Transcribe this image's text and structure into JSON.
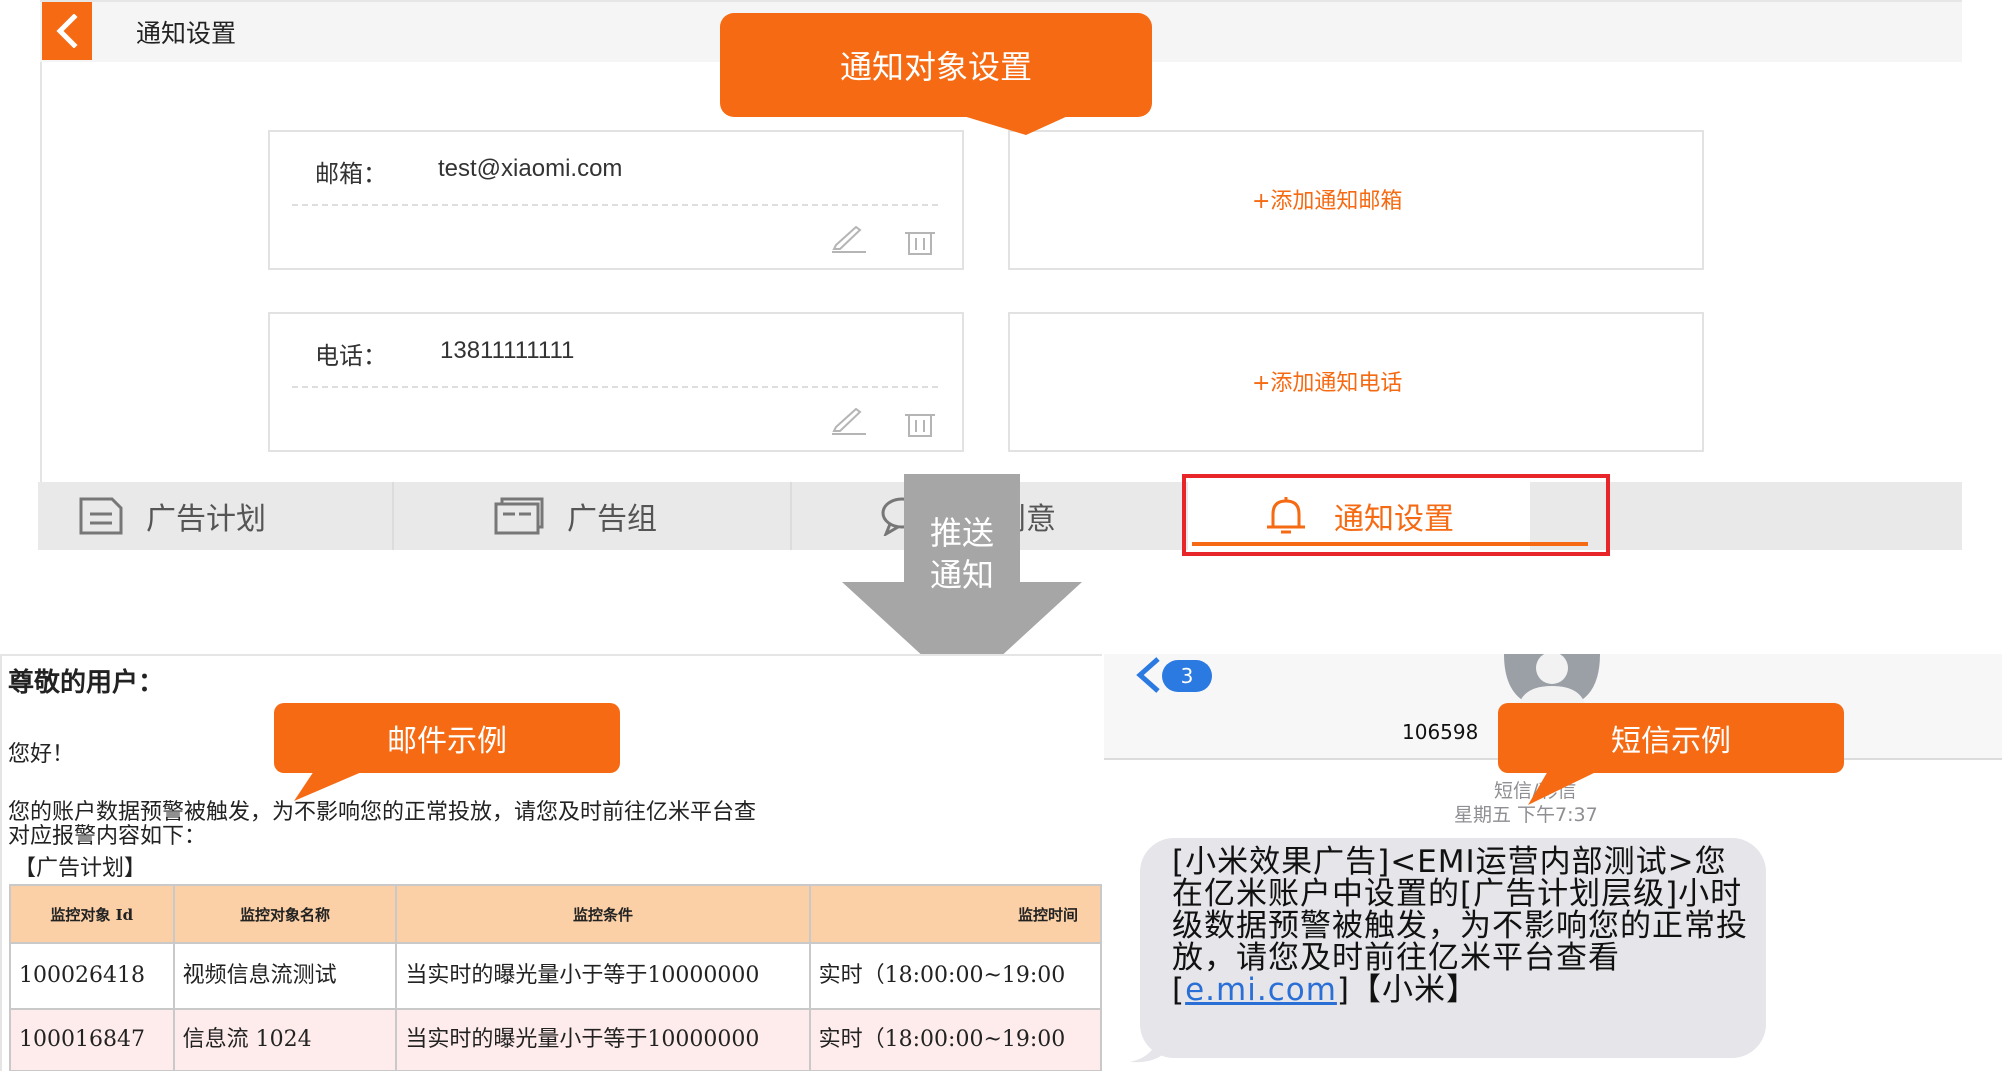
{
  "settings": {
    "header_title": "通知设置",
    "email_label": "邮箱：",
    "email_value": "test@xiaomi.com",
    "phone_label": "电话：",
    "phone_value": "13811111111",
    "add_email": "+添加通知邮箱",
    "add_phone": "+添加通知电话"
  },
  "tabs": [
    {
      "label": "广告计划",
      "icon": "document-icon"
    },
    {
      "label": "广告组",
      "icon": "folder-icon"
    },
    {
      "label": "广告创意",
      "icon": "chat-bubble-icon"
    },
    {
      "label": "通知设置",
      "icon": "bell-icon",
      "active": true
    }
  ],
  "callouts": {
    "target": "通知对象设置",
    "email_example": "邮件示例",
    "sms_example": "短信示例"
  },
  "arrow": {
    "line1": "推送",
    "line2": "通知"
  },
  "email": {
    "greeting": "尊敬的用户：",
    "hello": "您好！",
    "body": "您的账户数据预警被触发，为不影响您的正常投放，请您及时前往亿米平台查",
    "body2": "对应报警内容如下：",
    "section": "【广告计划】",
    "columns": [
      "监控对象 Id",
      "监控对象名称",
      "监控条件",
      "监控时间"
    ],
    "rows": [
      {
        "id": "100026418",
        "name": "视频信息流测试",
        "condition": "当实时的曝光量小于等于10000000",
        "time": "实时（18:00:00~19:00"
      },
      {
        "id": "100016847",
        "name": "信息流 1024",
        "condition": "当实时的曝光量小于等于10000000",
        "time": "实时（18:00:00~19:00"
      }
    ]
  },
  "sms": {
    "badge": "3",
    "sender": "106598",
    "type_label": "短信/彩信",
    "time": "星期五 下午7:37",
    "message_pre": "[小米效果广告]<EMI运营内部测试>您在亿米账户中设置的[广告计划层级]小时级数据预警被触发，为不影响您的正常投放，请您及时前往亿米平台查看[",
    "message_link": "e.mi.com",
    "message_post": "]【小米】"
  },
  "colors": {
    "accent": "#f56a12",
    "highlight_border": "#e8262a",
    "arrow_gray": "#a6a6a6",
    "ios_blue": "#2a7ae2"
  }
}
